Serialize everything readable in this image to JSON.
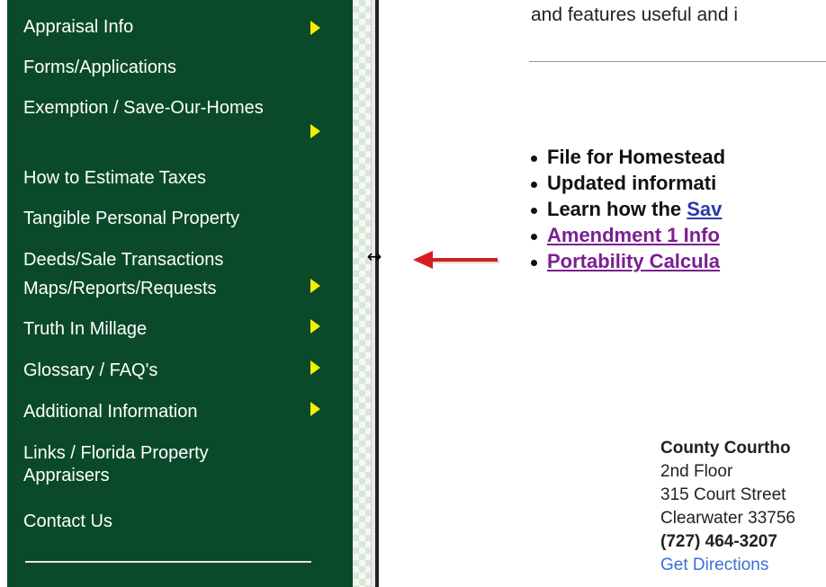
{
  "sidebar": {
    "items": [
      {
        "label": "Appraisal Info",
        "has_submenu": true
      },
      {
        "label": "Forms/Applications",
        "has_submenu": false
      },
      {
        "label": "Exemption / Save-Our-Homes",
        "has_submenu": true
      },
      {
        "label": "How to Estimate Taxes",
        "has_submenu": false
      },
      {
        "label": "Tangible Personal Property",
        "has_submenu": false
      },
      {
        "label": "Deeds/Sale Transactions",
        "has_submenu": false
      },
      {
        "label": "Maps/Reports/Requests",
        "has_submenu": true
      },
      {
        "label": "Truth In Millage",
        "has_submenu": true
      },
      {
        "label": "Glossary / FAQ's",
        "has_submenu": true
      },
      {
        "label": "Additional Information",
        "has_submenu": true
      },
      {
        "label": "Links / Florida Property Appraisers",
        "has_submenu": false
      },
      {
        "label": "Contact Us",
        "has_submenu": false
      }
    ]
  },
  "cursor_icon": "horizontal-resize-icon",
  "cursor_glyph": "↔",
  "annotation_icon": "red-arrow-icon",
  "main": {
    "intro_text": "and features useful and i",
    "bullets": [
      {
        "text": "File for Homestead",
        "link": ""
      },
      {
        "text": "Updated informati",
        "link": ""
      },
      {
        "text": "Learn how the ",
        "link": "Sav"
      },
      {
        "text": "",
        "link": "Amendment 1 Info"
      },
      {
        "text": "",
        "link": "Portability Calcula"
      }
    ]
  },
  "address": {
    "name": "County Courtho",
    "floor": "2nd Floor",
    "street": "315 Court Street",
    "city": "Clearwater 33756",
    "phone": "(727) 464-3207",
    "directions": "Get Directions"
  },
  "colors": {
    "sidebar_bg": "#0a4a2a",
    "submenu_arrow": "#f4f000",
    "annotation_red": "#d42020",
    "link_blue": "#2b3aa8",
    "link_purple": "#7b1f91"
  }
}
